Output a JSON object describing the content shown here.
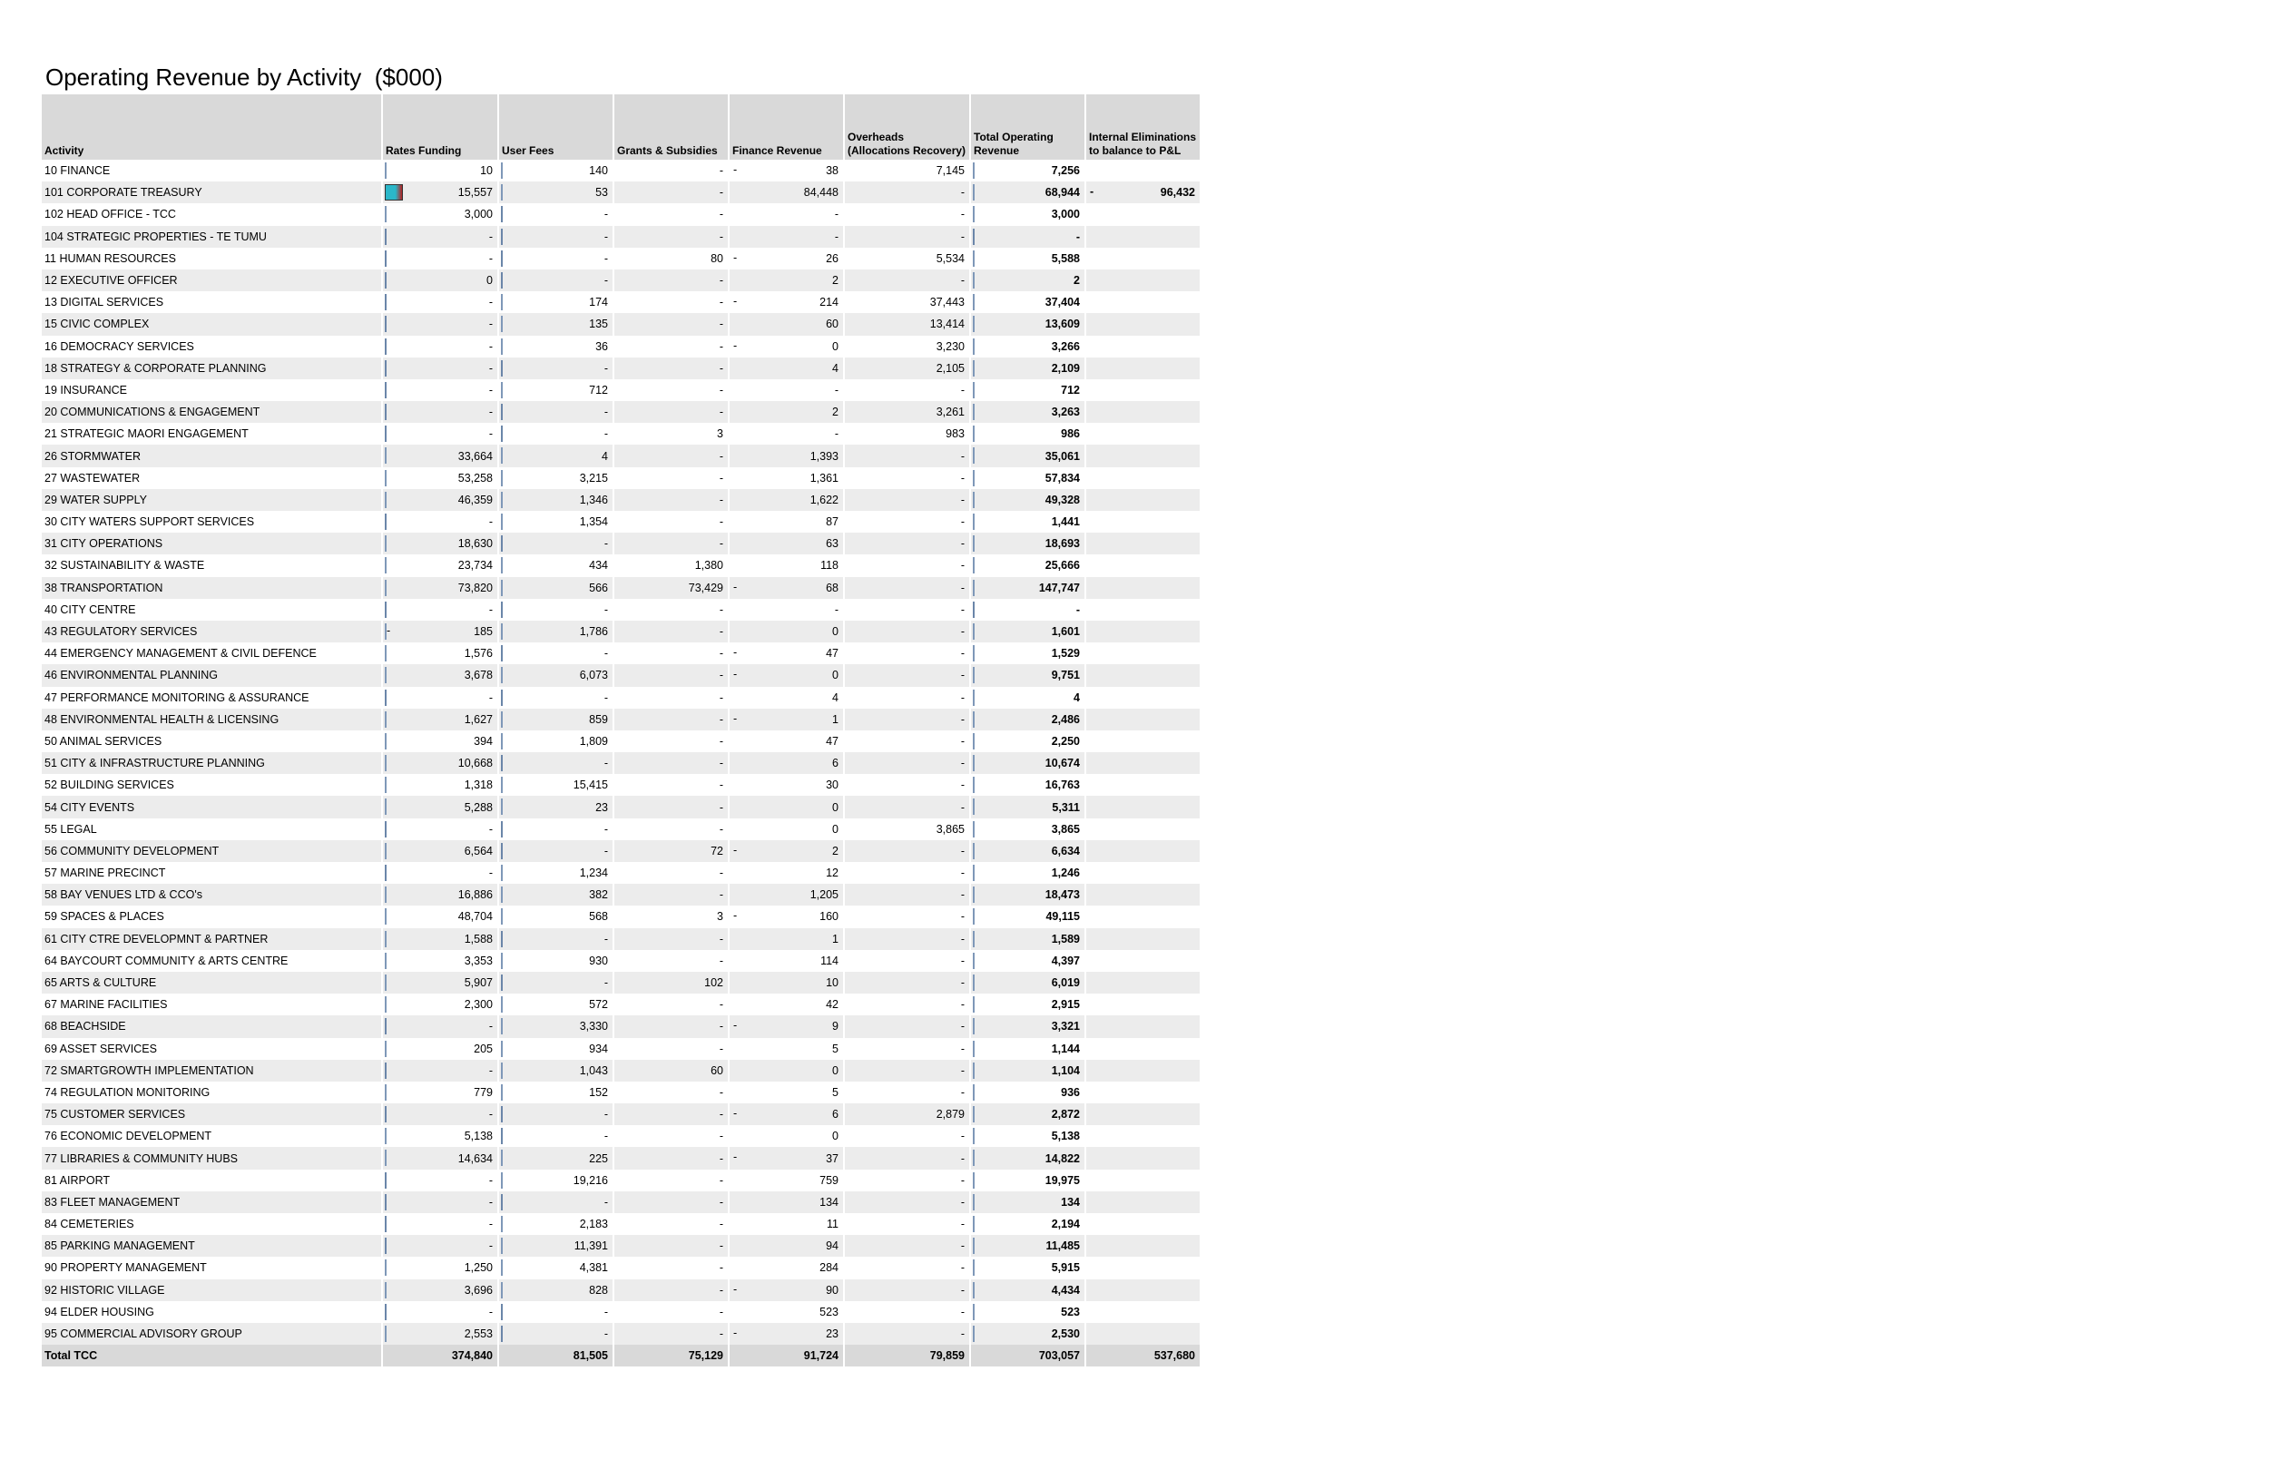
{
  "title": "Operating Revenue by Activity  ($000)",
  "headers": {
    "activity": "Activity",
    "rates": "Rates Funding",
    "fees": "User Fees",
    "grants": "Grants & Subsidies",
    "finance": "Finance Revenue",
    "overheads": "Overheads (Allocations Recovery)",
    "total": "Total Operating Revenue",
    "elim": "Internal Eliminations to balance to P&L"
  },
  "max_bar": {
    "rates": 73820,
    "fees": 19216,
    "total": 147747
  },
  "rows": [
    {
      "a": "10 FINANCE",
      "r": "10",
      "u": "140",
      "g": "-",
      "fp": "-",
      "f": "38",
      "o": "7,145",
      "t": "7,256",
      "e": ""
    },
    {
      "a": "101 CORPORATE TREASURY",
      "r": "15,557",
      "rneg": true,
      "u": "53",
      "g": "-",
      "f": "84,448",
      "o": "-",
      "t": "68,944",
      "ep": "-",
      "e": "96,432"
    },
    {
      "a": "102 HEAD OFFICE - TCC",
      "r": "3,000",
      "u": "-",
      "g": "-",
      "f": "-",
      "o": "-",
      "t": "3,000",
      "e": ""
    },
    {
      "a": "104 STRATEGIC PROPERTIES - TE TUMU",
      "r": "-",
      "u": "-",
      "g": "-",
      "f": "-",
      "o": "-",
      "t": "-",
      "e": ""
    },
    {
      "a": "11 HUMAN RESOURCES",
      "r": "-",
      "u": "-",
      "g": "80",
      "gp": "",
      "fp": "-",
      "f": "26",
      "o": "5,534",
      "t": "5,588",
      "e": ""
    },
    {
      "a": "12 EXECUTIVE OFFICER",
      "r": "0",
      "u": "-",
      "g": "-",
      "f": "2",
      "o": "-",
      "t": "2",
      "e": ""
    },
    {
      "a": "13 DIGITAL SERVICES",
      "r": "-",
      "u": "174",
      "g": "-",
      "fp": "-",
      "f": "214",
      "o": "37,443",
      "t": "37,404",
      "e": ""
    },
    {
      "a": "15 CIVIC COMPLEX",
      "r": "-",
      "u": "135",
      "g": "-",
      "f": "60",
      "o": "13,414",
      "t": "13,609",
      "e": ""
    },
    {
      "a": "16 DEMOCRACY SERVICES",
      "r": "-",
      "u": "36",
      "g": "-",
      "fp": "-",
      "f": "0",
      "o": "3,230",
      "t": "3,266",
      "e": ""
    },
    {
      "a": "18 STRATEGY & CORPORATE PLANNING",
      "r": "-",
      "u": "-",
      "g": "-",
      "f": "4",
      "o": "2,105",
      "t": "2,109",
      "e": ""
    },
    {
      "a": "19 INSURANCE",
      "r": "-",
      "u": "712",
      "g": "-",
      "f": "-",
      "o": "-",
      "t": "712",
      "e": ""
    },
    {
      "a": "20 COMMUNICATIONS & ENGAGEMENT",
      "r": "-",
      "u": "-",
      "g": "-",
      "f": "2",
      "o": "3,261",
      "t": "3,263",
      "e": ""
    },
    {
      "a": "21 STRATEGIC MAORI ENGAGEMENT",
      "r": "-",
      "u": "-",
      "g": "3",
      "f": "-",
      "o": "983",
      "t": "986",
      "e": ""
    },
    {
      "a": "26 STORMWATER",
      "r": "33,664",
      "u": "4",
      "g": "-",
      "f": "1,393",
      "o": "-",
      "t": "35,061",
      "e": ""
    },
    {
      "a": "27 WASTEWATER",
      "r": "53,258",
      "u": "3,215",
      "g": "-",
      "f": "1,361",
      "o": "-",
      "t": "57,834",
      "e": ""
    },
    {
      "a": "29 WATER SUPPLY",
      "r": "46,359",
      "u": "1,346",
      "g": "-",
      "f": "1,622",
      "o": "-",
      "t": "49,328",
      "e": ""
    },
    {
      "a": "30 CITY WATERS SUPPORT SERVICES",
      "r": "-",
      "u": "1,354",
      "g": "-",
      "f": "87",
      "o": "-",
      "t": "1,441",
      "e": ""
    },
    {
      "a": "31 CITY OPERATIONS",
      "r": "18,630",
      "u": "-",
      "g": "-",
      "f": "63",
      "o": "-",
      "t": "18,693",
      "e": ""
    },
    {
      "a": "32 SUSTAINABILITY & WASTE",
      "r": "23,734",
      "u": "434",
      "g": "1,380",
      "f": "118",
      "o": "-",
      "t": "25,666",
      "e": ""
    },
    {
      "a": "38 TRANSPORTATION",
      "r": "73,820",
      "u": "566",
      "g": "73,429",
      "fp": "-",
      "f": "68",
      "o": "-",
      "t": "147,747",
      "e": ""
    },
    {
      "a": "40 CITY CENTRE",
      "r": "-",
      "u": "-",
      "g": "-",
      "f": "-",
      "o": "-",
      "t": "-",
      "e": ""
    },
    {
      "a": "43 REGULATORY SERVICES",
      "rp": "-",
      "r": "185",
      "rneg2": true,
      "u": "1,786",
      "g": "-",
      "f": "0",
      "o": "-",
      "t": "1,601",
      "e": ""
    },
    {
      "a": "44 EMERGENCY MANAGEMENT & CIVIL DEFENCE",
      "r": "1,576",
      "u": "-",
      "g": "-",
      "fp": "-",
      "f": "47",
      "o": "-",
      "t": "1,529",
      "e": ""
    },
    {
      "a": "46 ENVIRONMENTAL PLANNING",
      "r": "3,678",
      "u": "6,073",
      "g": "-",
      "fp": "-",
      "f": "0",
      "o": "-",
      "t": "9,751",
      "e": ""
    },
    {
      "a": "47 PERFORMANCE MONITORING & ASSURANCE",
      "r": "-",
      "u": "-",
      "g": "-",
      "f": "4",
      "o": "-",
      "t": "4",
      "e": ""
    },
    {
      "a": "48 ENVIRONMENTAL HEALTH & LICENSING",
      "r": "1,627",
      "u": "859",
      "g": "-",
      "fp": "-",
      "f": "1",
      "o": "-",
      "t": "2,486",
      "e": ""
    },
    {
      "a": "50 ANIMAL SERVICES",
      "r": "394",
      "u": "1,809",
      "g": "-",
      "f": "47",
      "o": "-",
      "t": "2,250",
      "e": ""
    },
    {
      "a": "51 CITY & INFRASTRUCTURE PLANNING",
      "r": "10,668",
      "u": "-",
      "g": "-",
      "f": "6",
      "o": "-",
      "t": "10,674",
      "e": ""
    },
    {
      "a": "52 BUILDING SERVICES",
      "r": "1,318",
      "u": "15,415",
      "g": "-",
      "f": "30",
      "o": "-",
      "t": "16,763",
      "e": ""
    },
    {
      "a": "54 CITY EVENTS",
      "r": "5,288",
      "u": "23",
      "g": "-",
      "f": "0",
      "o": "-",
      "t": "5,311",
      "e": ""
    },
    {
      "a": "55 LEGAL",
      "r": "-",
      "u": "-",
      "g": "-",
      "f": "0",
      "o": "3,865",
      "t": "3,865",
      "e": ""
    },
    {
      "a": "56 COMMUNITY DEVELOPMENT",
      "r": "6,564",
      "u": "-",
      "g": "72",
      "fp": "-",
      "f": "2",
      "o": "-",
      "t": "6,634",
      "e": ""
    },
    {
      "a": "57 MARINE PRECINCT",
      "r": "-",
      "u": "1,234",
      "g": "-",
      "f": "12",
      "o": "-",
      "t": "1,246",
      "e": ""
    },
    {
      "a": "58 BAY VENUES LTD & CCO's",
      "r": "16,886",
      "u": "382",
      "g": "-",
      "f": "1,205",
      "o": "-",
      "t": "18,473",
      "e": ""
    },
    {
      "a": "59 SPACES & PLACES",
      "r": "48,704",
      "u": "568",
      "g": "3",
      "fp": "-",
      "f": "160",
      "o": "-",
      "t": "49,115",
      "e": ""
    },
    {
      "a": "61 CITY CTRE DEVELOPMNT & PARTNER",
      "r": "1,588",
      "u": "-",
      "g": "-",
      "f": "1",
      "o": "-",
      "t": "1,589",
      "e": ""
    },
    {
      "a": "64 BAYCOURT COMMUNITY & ARTS CENTRE",
      "r": "3,353",
      "u": "930",
      "g": "-",
      "f": "114",
      "o": "-",
      "t": "4,397",
      "e": ""
    },
    {
      "a": "65 ARTS & CULTURE",
      "r": "5,907",
      "u": "-",
      "g": "102",
      "f": "10",
      "o": "-",
      "t": "6,019",
      "e": ""
    },
    {
      "a": "67 MARINE FACILITIES",
      "r": "2,300",
      "u": "572",
      "g": "-",
      "f": "42",
      "o": "-",
      "t": "2,915",
      "e": ""
    },
    {
      "a": "68 BEACHSIDE",
      "r": "-",
      "u": "3,330",
      "g": "-",
      "fp": "-",
      "f": "9",
      "o": "-",
      "t": "3,321",
      "e": ""
    },
    {
      "a": "69 ASSET SERVICES",
      "r": "205",
      "u": "934",
      "g": "-",
      "f": "5",
      "o": "-",
      "t": "1,144",
      "e": ""
    },
    {
      "a": "72 SMARTGROWTH IMPLEMENTATION",
      "r": "-",
      "u": "1,043",
      "g": "60",
      "f": "0",
      "o": "-",
      "t": "1,104",
      "e": ""
    },
    {
      "a": "74 REGULATION MONITORING",
      "r": "779",
      "u": "152",
      "g": "-",
      "f": "5",
      "o": "-",
      "t": "936",
      "e": ""
    },
    {
      "a": "75 CUSTOMER SERVICES",
      "r": "-",
      "u": "-",
      "g": "-",
      "fp": "-",
      "f": "6",
      "o": "2,879",
      "t": "2,872",
      "e": ""
    },
    {
      "a": "76 ECONOMIC DEVELOPMENT",
      "r": "5,138",
      "u": "-",
      "g": "-",
      "f": "0",
      "o": "-",
      "t": "5,138",
      "e": ""
    },
    {
      "a": "77 LIBRARIES & COMMUNITY HUBS",
      "r": "14,634",
      "u": "225",
      "g": "-",
      "fp": "-",
      "f": "37",
      "o": "-",
      "t": "14,822",
      "e": ""
    },
    {
      "a": "81 AIRPORT",
      "r": "-",
      "u": "19,216",
      "g": "-",
      "f": "759",
      "o": "-",
      "t": "19,975",
      "e": ""
    },
    {
      "a": "83 FLEET MANAGEMENT",
      "r": "-",
      "u": "-",
      "g": "-",
      "f": "134",
      "o": "-",
      "t": "134",
      "e": ""
    },
    {
      "a": "84 CEMETERIES",
      "r": "-",
      "u": "2,183",
      "g": "-",
      "f": "11",
      "o": "-",
      "t": "2,194",
      "e": ""
    },
    {
      "a": "85 PARKING MANAGEMENT",
      "r": "-",
      "u": "11,391",
      "g": "-",
      "f": "94",
      "o": "-",
      "t": "11,485",
      "e": ""
    },
    {
      "a": "90 PROPERTY MANAGEMENT",
      "r": "1,250",
      "u": "4,381",
      "g": "-",
      "f": "284",
      "o": "-",
      "t": "5,915",
      "e": ""
    },
    {
      "a": "92 HISTORIC VILLAGE",
      "r": "3,696",
      "u": "828",
      "g": "-",
      "fp": "-",
      "f": "90",
      "o": "-",
      "t": "4,434",
      "e": ""
    },
    {
      "a": "94 ELDER HOUSING",
      "r": "-",
      "u": "-",
      "g": "-",
      "f": "523",
      "o": "-",
      "t": "523",
      "e": ""
    },
    {
      "a": "95 COMMERCIAL ADVISORY GROUP",
      "r": "2,553",
      "u": "-",
      "g": "-",
      "fp": "-",
      "f": "23",
      "o": "-",
      "t": "2,530",
      "e": ""
    }
  ],
  "total": {
    "a": "Total TCC",
    "r": "374,840",
    "u": "81,505",
    "g": "75,129",
    "f": "91,724",
    "o": "79,859",
    "t": "703,057",
    "e": "537,680"
  },
  "colors": {
    "header_bg": "#d9d9d9",
    "row_shade": "#ececec",
    "bar_border": "#7f98b8"
  }
}
